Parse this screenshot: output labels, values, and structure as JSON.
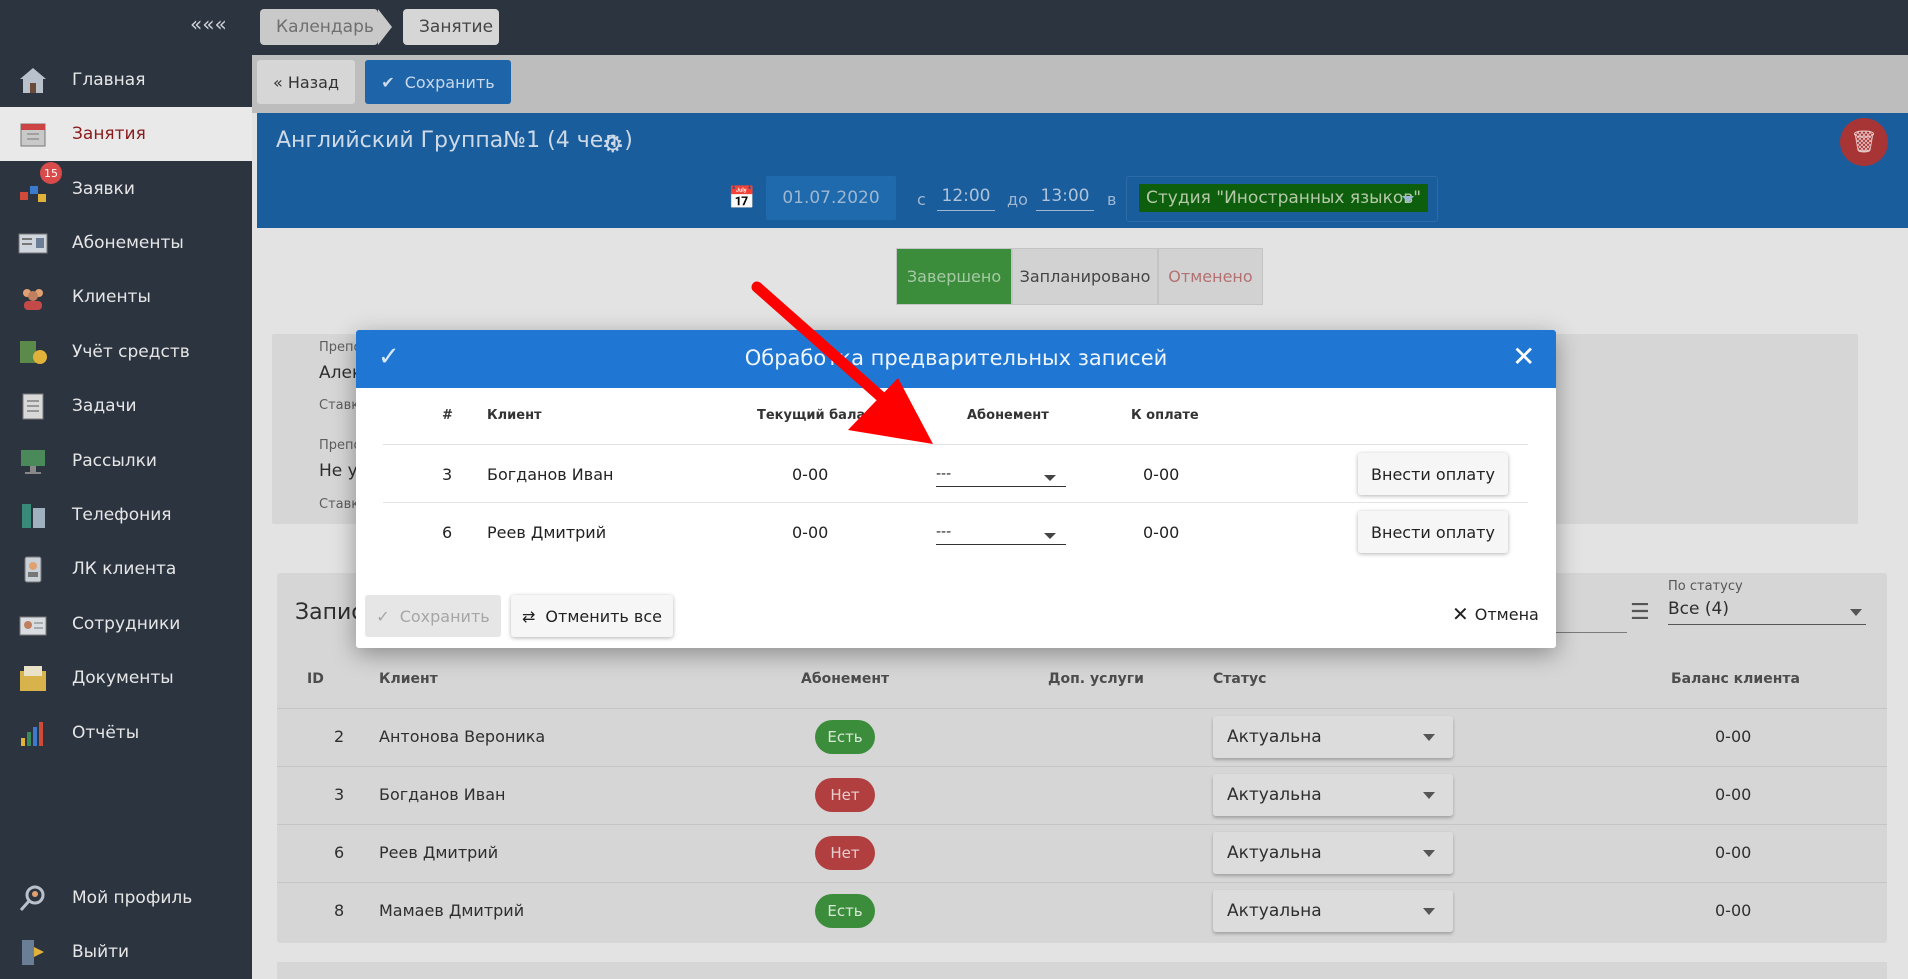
{
  "sidebar": {
    "collapse": "«««",
    "items": [
      {
        "label": "Главная",
        "icon": "home-icon"
      },
      {
        "label": "Занятия",
        "icon": "calendar-icon"
      },
      {
        "label": "Заявки",
        "icon": "requests-icon",
        "badge": "15"
      },
      {
        "label": "Абонементы",
        "icon": "subscription-icon"
      },
      {
        "label": "Клиенты",
        "icon": "clients-icon"
      },
      {
        "label": "Учёт средств",
        "icon": "money-icon"
      },
      {
        "label": "Задачи",
        "icon": "tasks-icon"
      },
      {
        "label": "Рассылки",
        "icon": "mailing-icon"
      },
      {
        "label": "Телефония",
        "icon": "phone-icon"
      },
      {
        "label": "ЛК клиента",
        "icon": "client-account-icon"
      },
      {
        "label": "Сотрудники",
        "icon": "staff-icon"
      },
      {
        "label": "Документы",
        "icon": "documents-icon"
      },
      {
        "label": "Отчёты",
        "icon": "reports-icon"
      }
    ],
    "profile": "Мой профиль",
    "logout": "Выйти"
  },
  "breadcrumbs": [
    "Календарь",
    "Занятие"
  ],
  "toolbar": {
    "back": "« Назад",
    "save": "Сохранить"
  },
  "lesson": {
    "title": "Английский Группа№1 (4 чел.)",
    "date": "01.07.2020",
    "from_label": "с",
    "from": "12:00",
    "to_label": "до",
    "to": "13:00",
    "in_label": "в",
    "studio": "Студия \"Иностранных языков\""
  },
  "status_tabs": [
    "Завершено",
    "Запланировано",
    "Отменено"
  ],
  "panel": {
    "teacher_label": "Препо",
    "teacher_value": "Алек",
    "rate_label": "Ставк",
    "teacher2_label": "Препо",
    "teacher2_value": "Не ук",
    "rate2_label": "Ставк"
  },
  "records": {
    "title": "Запис",
    "filter_label": "По статусу",
    "filter_value": "Все (4)",
    "headers": [
      "ID",
      "Клиент",
      "Абонемент",
      "Доп. услуги",
      "Статус",
      "Баланс клиента"
    ],
    "rows": [
      {
        "id": "2",
        "client": "Антонова Вероника",
        "sub": "Есть",
        "sub_ok": true,
        "status": "Актуальна",
        "balance": "0-00"
      },
      {
        "id": "3",
        "client": "Богданов Иван",
        "sub": "Нет",
        "sub_ok": false,
        "status": "Актуальна",
        "balance": "0-00"
      },
      {
        "id": "6",
        "client": "Реев Дмитрий",
        "sub": "Нет",
        "sub_ok": false,
        "status": "Актуальна",
        "balance": "0-00"
      },
      {
        "id": "8",
        "client": "Мамаев Дмитрий",
        "sub": "Есть",
        "sub_ok": true,
        "status": "Актуальна",
        "balance": "0-00"
      }
    ]
  },
  "modal": {
    "title": "Обработка предварительных записей",
    "headers": [
      "#",
      "Клиент",
      "Текущий баланс",
      "Абонемент",
      "К оплате"
    ],
    "rows": [
      {
        "num": "3",
        "client": "Богданов Иван",
        "balance": "0-00",
        "sub": "---",
        "pay": "0-00",
        "btn": "Внести оплату"
      },
      {
        "num": "6",
        "client": "Реев Дмитрий",
        "balance": "0-00",
        "sub": "---",
        "pay": "0-00",
        "btn": "Внести оплату"
      }
    ],
    "save": "Сохранить",
    "cancel_all": "Отменить все",
    "cancel": "Отмена"
  },
  "colors": {
    "accent": "#1f77d3",
    "arrow": "#ff0000",
    "success": "#3b8d3b",
    "danger": "#b23f3f"
  }
}
